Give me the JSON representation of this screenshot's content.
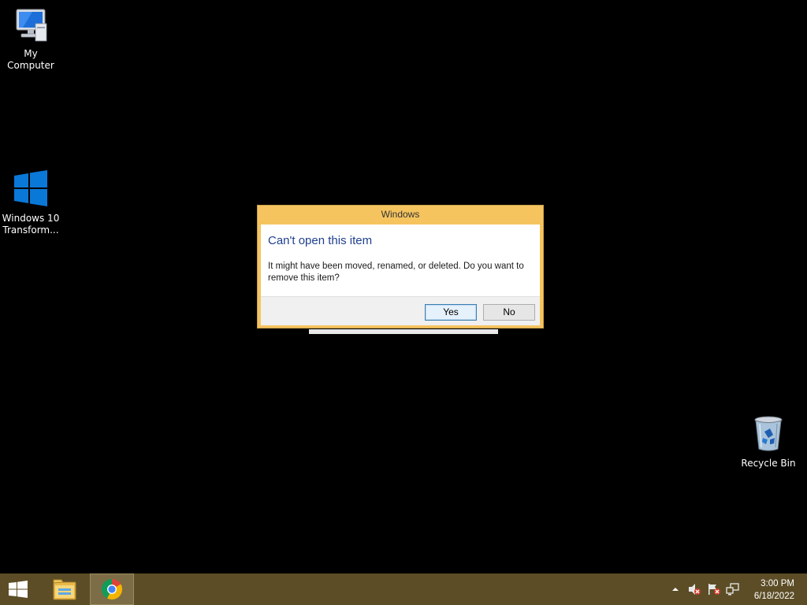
{
  "desktop": {
    "icons": [
      {
        "label": "My Computer",
        "icon": "computer-icon"
      },
      {
        "label": "Windows 10 Transform...",
        "icon": "windows-logo-icon"
      },
      {
        "label": "Recycle Bin",
        "icon": "recycle-bin-icon"
      }
    ]
  },
  "dialog": {
    "title": "Windows",
    "heading": "Can't open this item",
    "message": "It might have been moved, renamed, or deleted. Do you want to remove this item?",
    "yes_label": "Yes",
    "no_label": "No",
    "frame_color": "#f5c45f",
    "heading_color": "#1f3f8f"
  },
  "taskbar": {
    "color": "#5c4d26",
    "start_icon": "windows-start-icon",
    "apps": [
      {
        "icon": "file-explorer-icon",
        "active": false
      },
      {
        "icon": "chrome-icon",
        "active": true
      }
    ],
    "tray": {
      "icons": [
        "show-hidden-icons-chevron",
        "volume-muted-icon",
        "action-center-flag-icon",
        "network-icon"
      ],
      "time": "3:00 PM",
      "date": "6/18/2022"
    }
  }
}
